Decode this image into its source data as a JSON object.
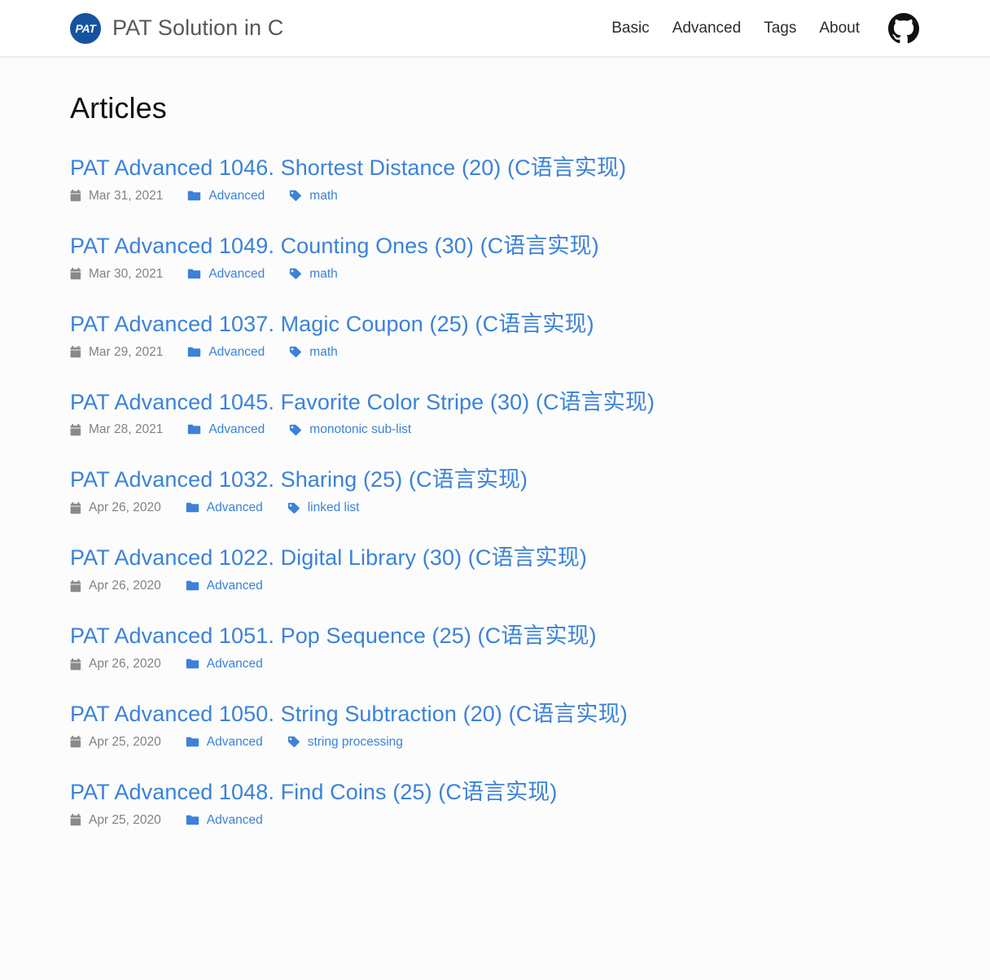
{
  "header": {
    "brand": {
      "logo_text": "PAT",
      "title": "PAT Solution in C"
    },
    "nav": [
      {
        "label": "Basic",
        "name": "nav-basic"
      },
      {
        "label": "Advanced",
        "name": "nav-advanced"
      },
      {
        "label": "Tags",
        "name": "nav-tags"
      },
      {
        "label": "About",
        "name": "nav-about"
      }
    ],
    "github_icon": "github-icon"
  },
  "main": {
    "page_title": "Articles",
    "icons": {
      "date": "calendar-icon",
      "category": "folder-icon",
      "tag": "tag-icon"
    },
    "posts": [
      {
        "title": "PAT Advanced 1046. Shortest Distance (20) (C语言实现)",
        "date": "Mar 31, 2021",
        "category": "Advanced",
        "tag": "math"
      },
      {
        "title": "PAT Advanced 1049. Counting Ones (30) (C语言实现)",
        "date": "Mar 30, 2021",
        "category": "Advanced",
        "tag": "math"
      },
      {
        "title": "PAT Advanced 1037. Magic Coupon (25) (C语言实现)",
        "date": "Mar 29, 2021",
        "category": "Advanced",
        "tag": "math"
      },
      {
        "title": "PAT Advanced 1045. Favorite Color Stripe (30) (C语言实现)",
        "date": "Mar 28, 2021",
        "category": "Advanced",
        "tag": "monotonic sub-list"
      },
      {
        "title": "PAT Advanced 1032. Sharing (25) (C语言实现)",
        "date": "Apr 26, 2020",
        "category": "Advanced",
        "tag": "linked list"
      },
      {
        "title": "PAT Advanced 1022. Digital Library (30) (C语言实现)",
        "date": "Apr 26, 2020",
        "category": "Advanced",
        "tag": null
      },
      {
        "title": "PAT Advanced 1051. Pop Sequence (25) (C语言实现)",
        "date": "Apr 26, 2020",
        "category": "Advanced",
        "tag": null
      },
      {
        "title": "PAT Advanced 1050. String Subtraction (20) (C语言实现)",
        "date": "Apr 25, 2020",
        "category": "Advanced",
        "tag": "string processing"
      },
      {
        "title": "PAT Advanced 1048. Find Coins (25) (C语言实现)",
        "date": "Apr 25, 2020",
        "category": "Advanced",
        "tag": null
      }
    ]
  },
  "colors": {
    "link_blue": "#3b82d8",
    "logo_blue": "#14539f",
    "meta_gray": "#828282",
    "icon_gray": "#8a8a8a",
    "heading": "#111111",
    "page_bg": "#fcfcfc",
    "header_bg": "#ffffff"
  }
}
